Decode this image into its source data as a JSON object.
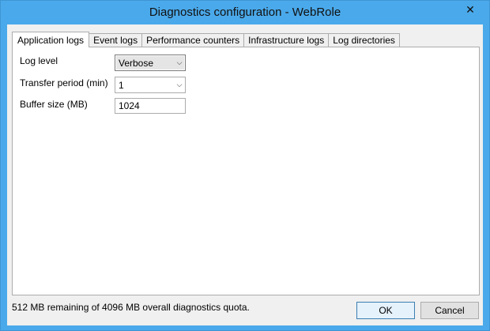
{
  "window": {
    "title": "Diagnostics configuration - WebRole",
    "close_glyph": "✕"
  },
  "tabs": [
    {
      "label": "Application logs",
      "active": true
    },
    {
      "label": "Event logs",
      "active": false
    },
    {
      "label": "Performance counters",
      "active": false
    },
    {
      "label": "Infrastructure logs",
      "active": false
    },
    {
      "label": "Log directories",
      "active": false
    }
  ],
  "form": {
    "log_level": {
      "label": "Log level",
      "value": "Verbose"
    },
    "transfer_period": {
      "label": "Transfer period (min)",
      "value": "1"
    },
    "buffer_size": {
      "label": "Buffer size (MB)",
      "value": "1024"
    }
  },
  "status": {
    "quota_text": "512 MB remaining of 4096 MB overall diagnostics quota."
  },
  "buttons": {
    "ok_label": "OK",
    "cancel_label": "Cancel"
  },
  "icons": {
    "chevron": "chevron-down-icon",
    "close": "close-icon"
  },
  "colors": {
    "titlebar": "#4aa9ea",
    "dialog_bg": "#f0f0f0"
  }
}
